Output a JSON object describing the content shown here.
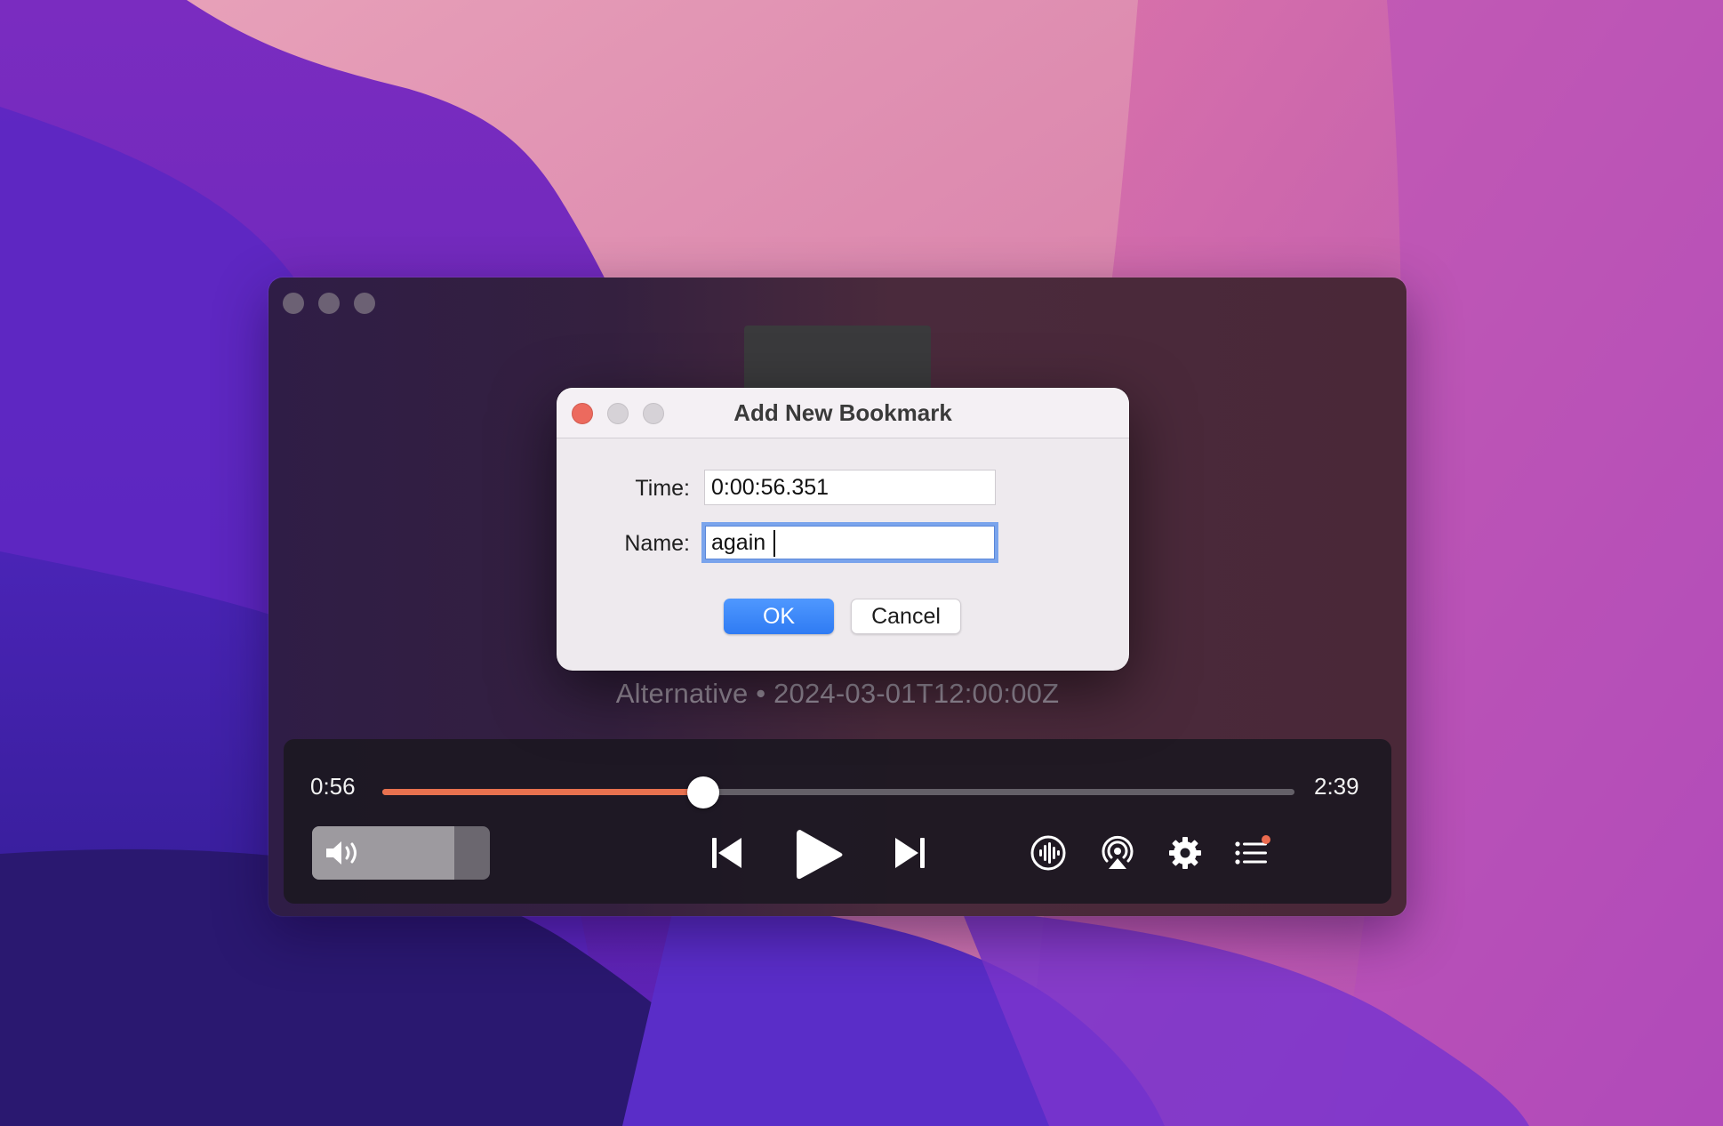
{
  "player": {
    "subtitle": "Alternative • 2024-03-01T12:00:00Z",
    "current_time": "0:56",
    "total_time": "2:39",
    "progress": 0.352,
    "volume": 0.8,
    "accent_color": "#e8714f",
    "controls": {
      "volume_icon": "speaker-icon",
      "previous_icon": "skip-previous-icon",
      "play_icon": "play-icon",
      "next_icon": "skip-next-icon",
      "audio_icon": "waveform-icon",
      "airplay_icon": "airplay-icon",
      "settings_icon": "gear-icon",
      "playlist_icon": "playlist-icon"
    }
  },
  "dialog": {
    "title": "Add New Bookmark",
    "time_label": "Time:",
    "time_value": "0:00:56.351",
    "name_label": "Name:",
    "name_value": "again ",
    "ok_label": "OK",
    "cancel_label": "Cancel",
    "close_color": "#ec6a5e"
  }
}
